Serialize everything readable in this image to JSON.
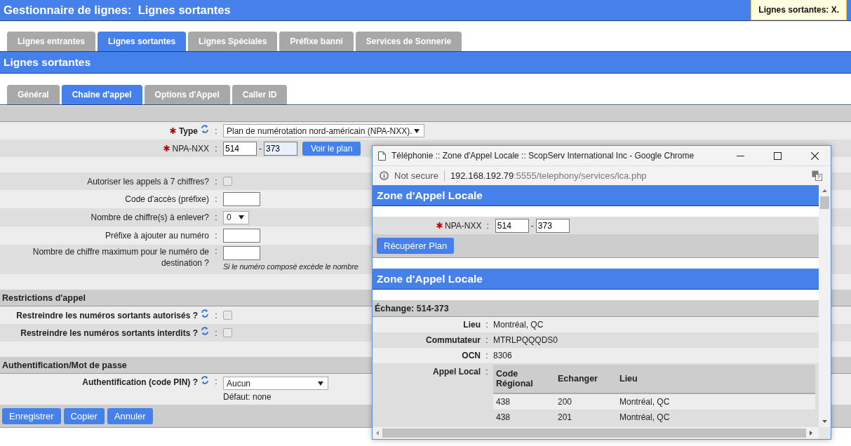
{
  "header": {
    "title": "Gestionnaire de lignes:  Lignes sortantes",
    "tooltip": "Lignes sortantes: X."
  },
  "tabs": [
    {
      "label": "Lignes entrantes",
      "selected": false
    },
    {
      "label": "Lignes sortantes",
      "selected": true
    },
    {
      "label": "Lignes Spéciales",
      "selected": false
    },
    {
      "label": "Préfixe banni",
      "selected": false
    },
    {
      "label": "Services de Sonnerie",
      "selected": false
    }
  ],
  "section_title": "Lignes sortantes",
  "subtabs": [
    {
      "label": "Général",
      "selected": false
    },
    {
      "label": "Chaîne d'appel",
      "selected": true
    },
    {
      "label": "Options d'Appel",
      "selected": false
    },
    {
      "label": "Caller ID",
      "selected": false
    }
  ],
  "sections": [
    {
      "rows": [
        {
          "kind": "select",
          "label": "Type",
          "required": true,
          "bold": true,
          "sync_icon": true,
          "separator": ":",
          "value": "Plan de numérotation nord-américain (NPA-NXX)."
        },
        {
          "kind": "npa",
          "label": "NPA-NXX",
          "required": true,
          "bold": false,
          "sync_icon": false,
          "separator": ":",
          "npa": "514",
          "dash": "-",
          "nxx": "373",
          "button": "Voir le plan"
        },
        {
          "kind": "spacer"
        },
        {
          "kind": "checkbox",
          "label": "Autoriser les appels à 7 chiffres?",
          "required": false,
          "bold": false,
          "sync_icon": false,
          "separator": ":",
          "checked": false
        },
        {
          "kind": "input",
          "label": "Code d'accès (préfixe)",
          "required": false,
          "bold": false,
          "sync_icon": false,
          "separator": ":"
        },
        {
          "kind": "small-select",
          "label": "Nombre de chiffre(s) à enlever?",
          "required": false,
          "bold": false,
          "sync_icon": false,
          "separator": ":",
          "value": "0"
        },
        {
          "kind": "input",
          "label": "Préfixe à ajouter au numéro",
          "required": false,
          "bold": false,
          "sync_icon": false,
          "separator": ":"
        },
        {
          "kind": "input",
          "label": "Nombre de chiffre maximum pour le numéro de destination ?",
          "required": false,
          "bold": false,
          "sync_icon": false,
          "separator": ":",
          "hint": "Si le numéro composé excède le nombre"
        },
        {
          "kind": "spacer"
        }
      ]
    },
    {
      "title": "Restrictions d'appel",
      "rows": [
        {
          "kind": "checkbox",
          "label": "Restreindre les numéros sortants autorisés ?",
          "required": false,
          "bold": true,
          "sync_icon": true,
          "separator": ":",
          "checked": false
        },
        {
          "kind": "checkbox",
          "label": "Restreindre les numéros sortants interdits ?",
          "required": false,
          "bold": true,
          "sync_icon": true,
          "separator": ":",
          "checked": false
        },
        {
          "kind": "spacer"
        }
      ]
    },
    {
      "title": "Authentification/Mot de passe",
      "rows": [
        {
          "kind": "select",
          "label": "Authentification (code PIN) ?",
          "required": false,
          "bold": true,
          "sync_icon": true,
          "separator": ":",
          "value": "Aucun",
          "hint": "Défaut: none"
        }
      ]
    }
  ],
  "buttons": [
    "Enregistrer",
    "Copier",
    "Annuler"
  ],
  "popup": {
    "window_title": "Téléphonie :: Zone d'Appel Locale :: ScopServ International Inc - Google Chrome",
    "security": "Not secure",
    "url_host": "192.168.192.79",
    "url_rest": ":5555/telephony/services/lca.php",
    "title": "Zone d'Appel Locale",
    "npa_label": "NPA-NXX",
    "separator": ":",
    "npa": "514",
    "dash": "-",
    "nxx": "373",
    "button": "Récupérer Plan",
    "result_title": "Zone d'Appel Locale",
    "exchange": "Échange: 514-373",
    "details": [
      {
        "label": "Lieu",
        "separator": ":",
        "value": "Montréal, QC"
      },
      {
        "label": "Commutateur",
        "separator": ":",
        "value": "MTRLPQQQDS0"
      },
      {
        "label": "OCN",
        "separator": ":",
        "value": "8306"
      }
    ],
    "local_label": "Appel Local",
    "local_separator": ":",
    "table": {
      "columns": [
        "Code Régional",
        "Echanger",
        "Lieu"
      ],
      "rows": [
        [
          "438",
          "200",
          "Montréal, QC"
        ],
        [
          "438",
          "201",
          "Montréal, QC"
        ]
      ]
    }
  }
}
